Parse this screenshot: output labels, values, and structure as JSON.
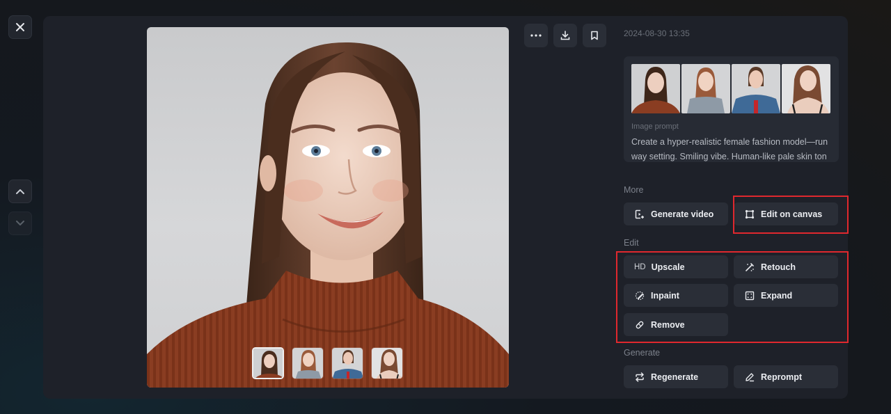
{
  "nav": {
    "close_icon": "close-icon",
    "prev_icon": "chevron-up-icon",
    "next_icon": "chevron-down-icon"
  },
  "viewer": {
    "main_image_alt": "Portrait of a smiling female model with long brown hair wearing a rust-colored ribbed turtleneck sweater",
    "thumbnails": [
      {
        "alt": "Model in rust turtleneck sweater",
        "selected": true
      },
      {
        "alt": "Red-haired model in grey sleeveless top",
        "selected": false
      },
      {
        "alt": "Model in denim jacket with red top",
        "selected": false
      },
      {
        "alt": "Model in strappy top",
        "selected": false
      }
    ]
  },
  "toolbar": {
    "more_icon": "ellipsis-icon",
    "download_icon": "download-icon",
    "bookmark_icon": "bookmark-icon"
  },
  "details": {
    "timestamp": "2024-08-30 13:35",
    "prompt_label": "Image prompt",
    "prompt_line_1": "Create a hyper-realistic female fashion model—run",
    "prompt_line_2": "way setting. Smiling vibe. Human-like pale skin ton"
  },
  "sections": {
    "more": {
      "label": "More",
      "buttons": [
        {
          "label": "Generate video",
          "icon": "video-add-icon"
        },
        {
          "label": "Edit on canvas",
          "icon": "canvas-edit-icon",
          "highlighted": true
        }
      ]
    },
    "edit": {
      "label": "Edit",
      "highlighted": true,
      "buttons": [
        {
          "label": "Upscale",
          "icon_text": "HD"
        },
        {
          "label": "Retouch",
          "icon": "magic-wand-icon"
        },
        {
          "label": "Inpaint",
          "icon": "inpaint-brush-icon"
        },
        {
          "label": "Expand",
          "icon": "expand-icon"
        },
        {
          "label": "Remove",
          "icon": "eraser-icon"
        }
      ]
    },
    "generate": {
      "label": "Generate",
      "buttons": [
        {
          "label": "Regenerate",
          "icon": "regenerate-icon"
        },
        {
          "label": "Reprompt",
          "icon": "pencil-icon"
        }
      ]
    }
  },
  "colors": {
    "highlight": "#e0282e",
    "panel": "#1e2129",
    "button": "#2a2e37"
  }
}
